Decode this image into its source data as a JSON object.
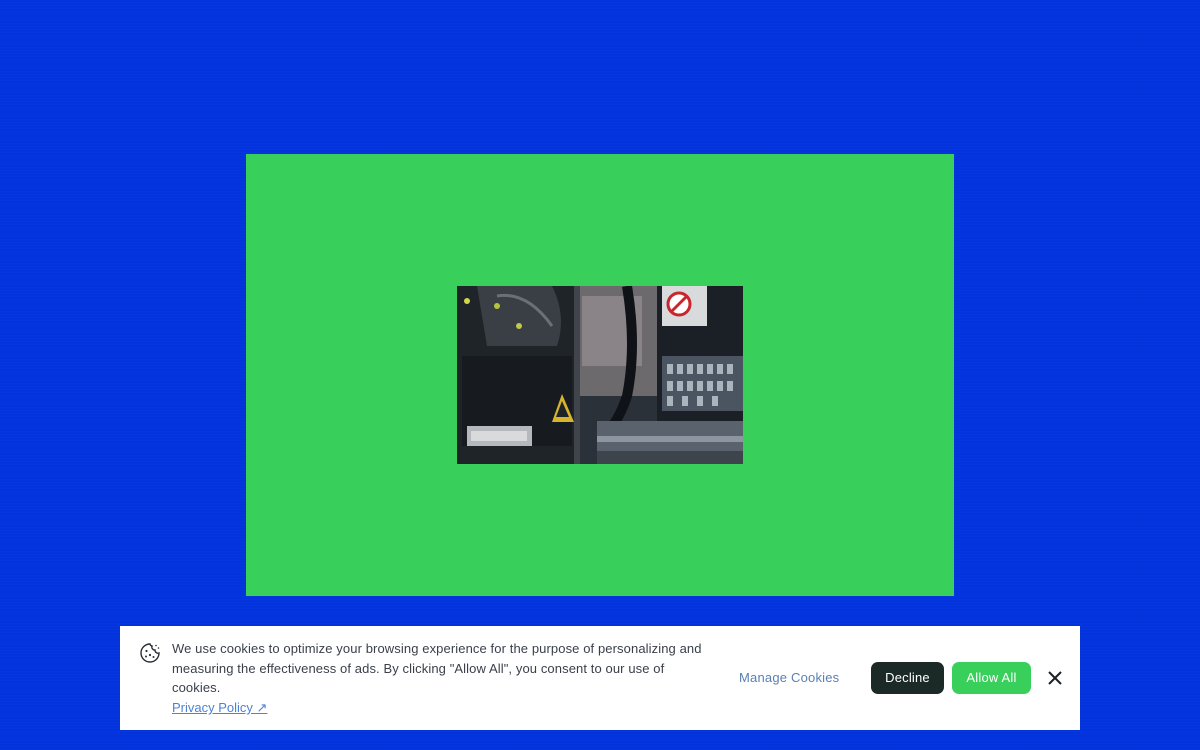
{
  "colors": {
    "page_background": "#0233de",
    "hero_panel": "#38d05b",
    "decline_button": "#1c2a27",
    "allow_button": "#38d05b",
    "link": "#4d83d6"
  },
  "hero": {
    "image_icon": "machinery-photo"
  },
  "cookie_banner": {
    "icon": "cookie-icon",
    "message": "We use cookies to optimize your browsing experience for the purpose of personalizing and measuring the effectiveness of ads. By clicking \"Allow All\", you consent to our use of cookies.",
    "privacy_link": "Privacy Policy ↗",
    "manage_label": "Manage Cookies",
    "decline_label": "Decline",
    "allow_label": "Allow All",
    "close_icon": "close-icon"
  }
}
